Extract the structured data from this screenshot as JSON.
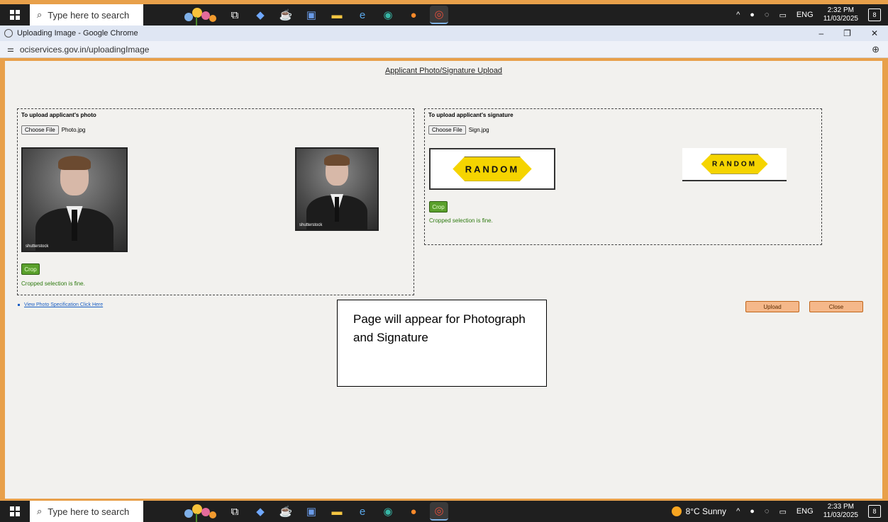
{
  "taskbar_top": {
    "search_placeholder": "Type here to search",
    "time": "2:32 PM",
    "date": "11/03/2025",
    "lang": "ENG",
    "notif_count": "8"
  },
  "taskbar_bottom": {
    "search_placeholder": "Type here to search",
    "weather": "8°C Sunny",
    "time": "2:33 PM",
    "date": "11/03/2025",
    "lang": "ENG",
    "notif_count": "8"
  },
  "taskbar_icons": [
    "task-view-icon",
    "copilot-icon",
    "java-icon",
    "word-icon",
    "file-explorer-icon",
    "internet-explorer-icon",
    "edge-icon",
    "firefox-icon",
    "chrome-icon"
  ],
  "browser": {
    "window_title": "Uploading Image - Google Chrome",
    "url": "ociservices.gov.in/uploadingImage"
  },
  "page": {
    "title": "Applicant Photo/Signature Upload",
    "photo_panel": {
      "heading": "To upload applicant's photo",
      "choose_label": "Choose File",
      "file_name": "Photo.jpg",
      "watermark": "shutterstock",
      "crop_label": "Crop",
      "status": "Cropped selection is fine."
    },
    "signature_panel": {
      "heading": "To upload applicant's signature",
      "choose_label": "Choose File",
      "file_name": "Sign.jpg",
      "sign_text": "RANDOM",
      "crop_label": "Crop",
      "status": "Cropped selection is fine."
    },
    "spec_link": "View Photo Specification Click Here",
    "upload_label": "Upload",
    "close_label": "Close",
    "note_text": "Page will appear for Photograph and Signature"
  },
  "colors": {
    "frame": "#e8a04a",
    "page_bg": "#f2f1ee",
    "crop_green": "#5aa02c",
    "status_green": "#2d7a0f",
    "button_orange": "#f5b88a"
  }
}
